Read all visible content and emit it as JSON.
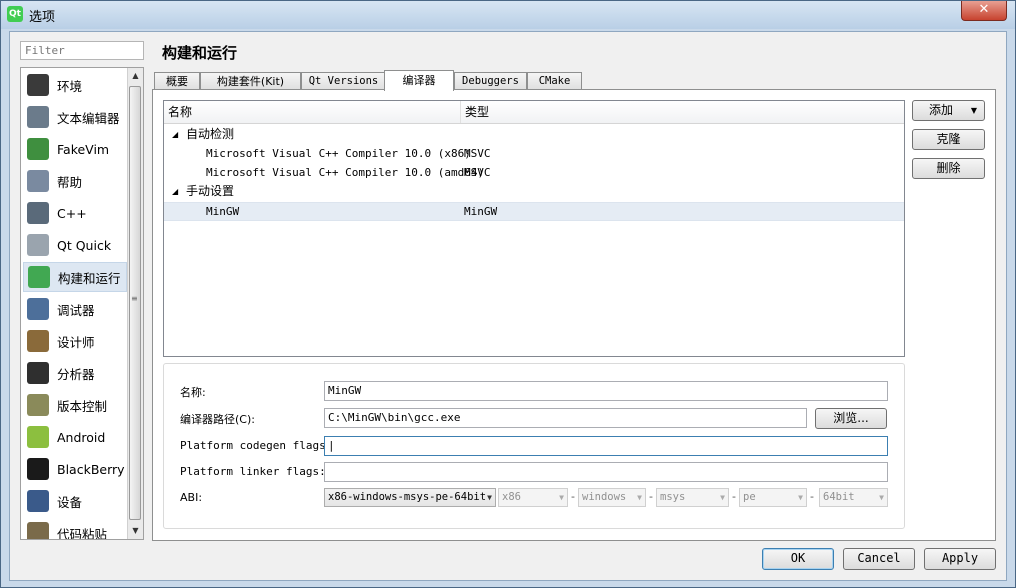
{
  "window": {
    "title": "选项",
    "app_icon_text": "Qt",
    "close_label": "✕"
  },
  "filter": {
    "placeholder": "Filter"
  },
  "categories": [
    {
      "label": "环境",
      "icon": "monitor-icon",
      "color": "#3a3a3a"
    },
    {
      "label": "文本编辑器",
      "icon": "text-editor-icon",
      "color": "#6b7b8b"
    },
    {
      "label": "FakeVim",
      "icon": "fakevim-icon",
      "color": "#3f8f3f"
    },
    {
      "label": "帮助",
      "icon": "help-icon",
      "color": "#7a8aa0"
    },
    {
      "label": "C++",
      "icon": "cpp-braces-icon",
      "color": "#5a6a7a"
    },
    {
      "label": "Qt Quick",
      "icon": "qt-quick-icon",
      "color": "#9aa4ae"
    },
    {
      "label": "构建和运行",
      "icon": "build-run-icon",
      "color": "#41a852"
    },
    {
      "label": "调试器",
      "icon": "debugger-icon",
      "color": "#4d6f9a"
    },
    {
      "label": "设计师",
      "icon": "designer-icon",
      "color": "#8a6a3a"
    },
    {
      "label": "分析器",
      "icon": "analyzer-icon",
      "color": "#2f2f2f"
    },
    {
      "label": "版本控制",
      "icon": "version-control-icon",
      "color": "#8a8a5a"
    },
    {
      "label": "Android",
      "icon": "android-icon",
      "color": "#8cbf3f"
    },
    {
      "label": "BlackBerry",
      "icon": "blackberry-icon",
      "color": "#1a1a1a"
    },
    {
      "label": "设备",
      "icon": "device-icon",
      "color": "#3a5a8a"
    },
    {
      "label": "代码粘贴",
      "icon": "code-paste-icon",
      "color": "#7a6a4a"
    }
  ],
  "page_title": "构建和运行",
  "tabs": [
    "概要",
    "构建套件(Kit)",
    "Qt Versions",
    "编译器",
    "Debuggers",
    "CMake"
  ],
  "tree": {
    "col_name": "名称",
    "col_type": "类型",
    "auto_group": "自动检测",
    "manual_group": "手动设置",
    "expander": "◢",
    "auto_items": [
      {
        "name": "Microsoft Visual C++ Compiler 10.0 (x86)",
        "type": "MSVC"
      },
      {
        "name": "Microsoft Visual C++ Compiler 10.0 (amd64)",
        "type": "MSVC"
      }
    ],
    "manual_items": [
      {
        "name": "MinGW",
        "type": "MinGW"
      }
    ]
  },
  "side_buttons": {
    "add": "添加",
    "clone": "克隆",
    "delete": "删除"
  },
  "details": {
    "name_label": "名称:",
    "name_value": "MinGW",
    "path_label": "编译器路径(C):",
    "path_value": "C:\\MinGW\\bin\\gcc.exe",
    "browse": "浏览...",
    "codegen_label": "Platform codegen flags:",
    "codegen_value": "|",
    "linker_label": "Platform linker flags:",
    "linker_value": "",
    "abi_label": "ABI:",
    "abi_value": "x86-windows-msys-pe-64bit",
    "abi_parts": [
      "x86",
      "windows",
      "msys",
      "pe",
      "64bit"
    ],
    "dash": "-"
  },
  "footer": {
    "ok": "OK",
    "cancel": "Cancel",
    "apply": "Apply"
  }
}
